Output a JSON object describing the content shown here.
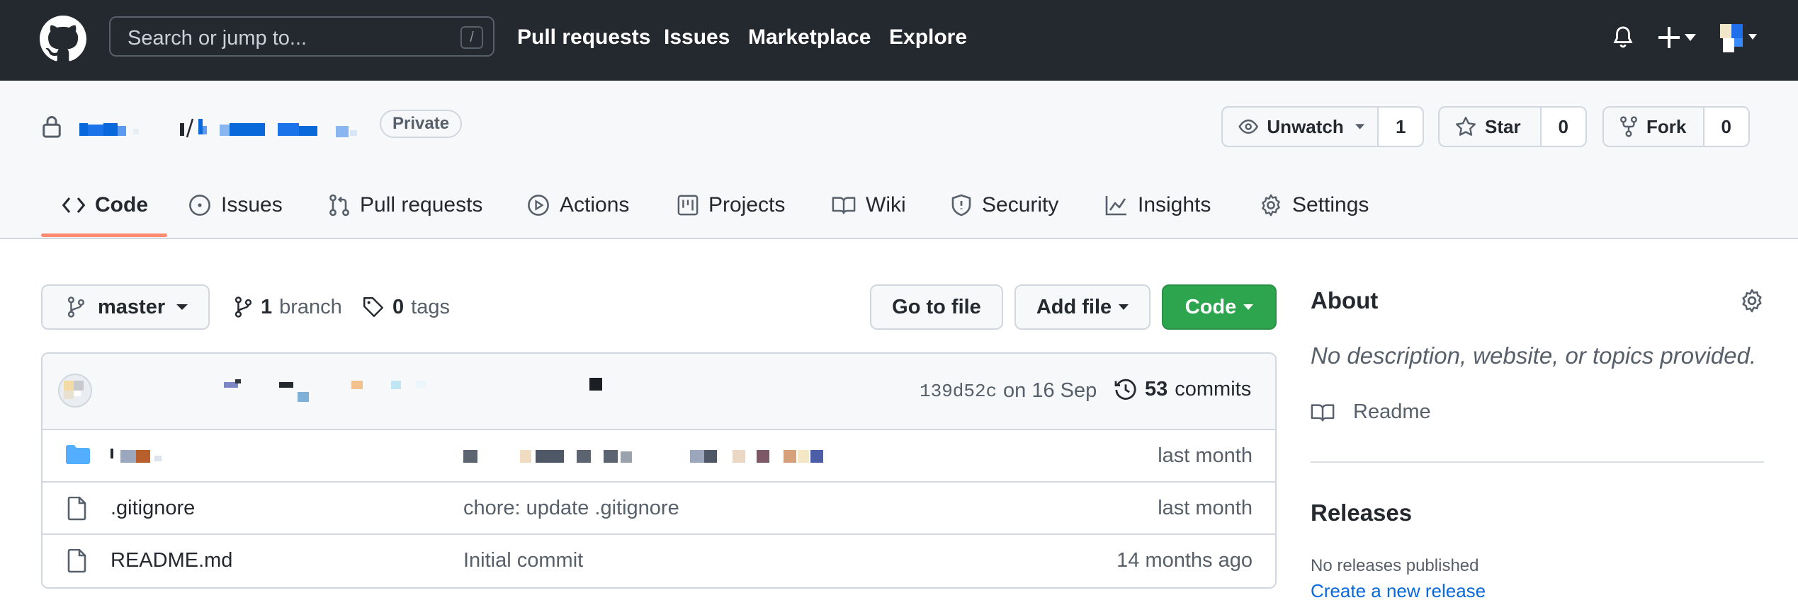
{
  "header": {
    "search_placeholder": "Search or jump to...",
    "search_shortcut": "/",
    "nav": [
      "Pull requests",
      "Issues",
      "Marketplace",
      "Explore"
    ]
  },
  "repo": {
    "visibility": "Private",
    "actions": {
      "watch": {
        "label": "Unwatch",
        "count": "1"
      },
      "star": {
        "label": "Star",
        "count": "0"
      },
      "fork": {
        "label": "Fork",
        "count": "0"
      }
    },
    "tabs": [
      "Code",
      "Issues",
      "Pull requests",
      "Actions",
      "Projects",
      "Wiki",
      "Security",
      "Insights",
      "Settings"
    ],
    "active_tab": "Code"
  },
  "code": {
    "branch": "master",
    "branch_count": "1",
    "branch_label": "branch",
    "tag_count": "0",
    "tag_label": "tags",
    "go_to_file": "Go to file",
    "add_file": "Add file",
    "code_button": "Code"
  },
  "latest_commit": {
    "sha": "139d52c",
    "date": "on 16 Sep",
    "commit_count": "53",
    "commit_label": "commits"
  },
  "files": [
    {
      "type": "folder",
      "name": "",
      "message": "",
      "age": "last month"
    },
    {
      "type": "file",
      "name": ".gitignore",
      "message": "chore: update .gitignore",
      "age": "last month"
    },
    {
      "type": "file",
      "name": "README.md",
      "message": "Initial commit",
      "age": "14 months ago"
    }
  ],
  "sidebar": {
    "about_title": "About",
    "about_desc": "No description, website, or topics provided.",
    "readme": "Readme",
    "releases_title": "Releases",
    "no_releases": "No releases published",
    "create_release": "Create a new release"
  },
  "colors": {
    "header_bg": "#24292f",
    "accent_underline": "#fd8c73",
    "green_button": "#2da44e",
    "link": "#0969da",
    "folder": "#54aeff"
  }
}
